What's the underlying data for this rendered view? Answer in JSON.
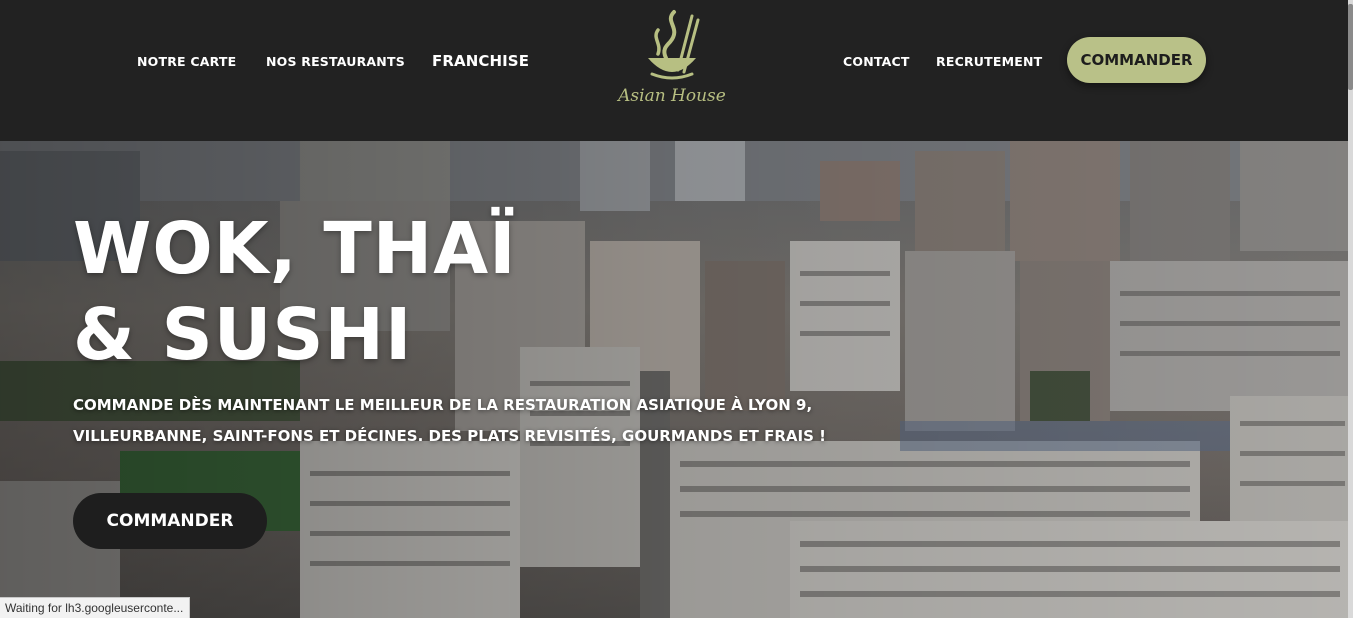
{
  "header": {
    "nav_left": [
      "NOTRE CARTE",
      "NOS RESTAURANTS",
      "FRANCHISE"
    ],
    "nav_right": [
      "CONTACT",
      "RECRUTEMENT"
    ],
    "logo_text": "Asian House",
    "cta_label": "COMMANDER"
  },
  "hero": {
    "title_line1": "WOK, THAÏ",
    "title_line2": "& SUSHI",
    "subtitle_line1": "COMMANDE DÈS MAINTENANT LE MEILLEUR DE LA RESTAURATION ASIATIQUE À LYON 9,",
    "subtitle_line2": "VILLEURBANNE, SAINT-FONS ET DÉCINES. DES PLATS REVISITÉS, GOURMANDS ET FRAIS !",
    "cta_label": "COMMANDER"
  },
  "status": {
    "text": "Waiting for lh3.googleuserconte..."
  },
  "colors": {
    "header_bg": "#222222",
    "accent": "#b9c188",
    "logo_color": "#b7bf82",
    "hero_button_bg": "#1e1e1e"
  },
  "icons": {
    "logo": "chopsticks-bowl-flame-icon"
  }
}
